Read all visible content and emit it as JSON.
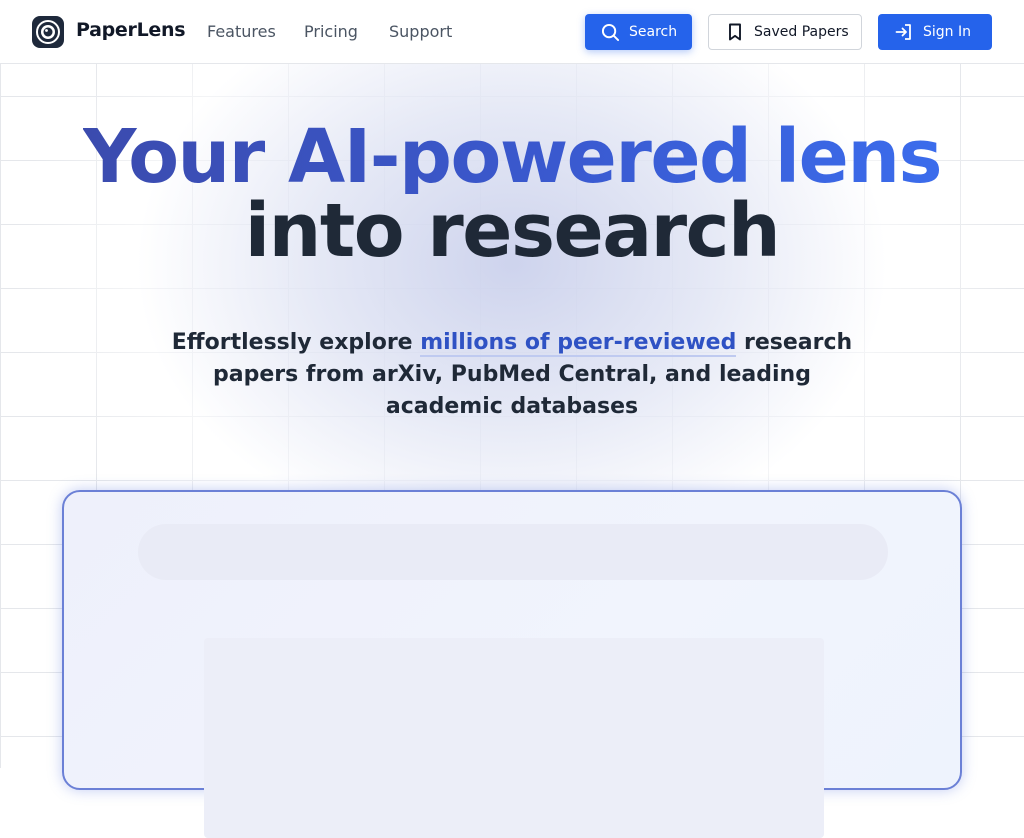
{
  "header": {
    "brand": "PaperLens",
    "logo_icon": "camera-lens-icon",
    "nav": [
      "Features",
      "Pricing",
      "Support"
    ],
    "search_button": "Search",
    "saved_button": "Saved Papers",
    "signin_button": "Sign In"
  },
  "hero": {
    "title_line1": "Your AI-powered lens",
    "title_line2": "into research",
    "subtitle_pre": "Effortlessly explore ",
    "subtitle_highlight": "millions of peer-reviewed",
    "subtitle_post": " research papers from arXiv, PubMed Central, and leading academic databases"
  },
  "colors": {
    "primary": "#2563eb",
    "title_gradient_start": "#3b4bae",
    "title_gradient_end": "#3b6cec",
    "text_dark": "#1f2937",
    "highlight": "#2f52c4"
  }
}
